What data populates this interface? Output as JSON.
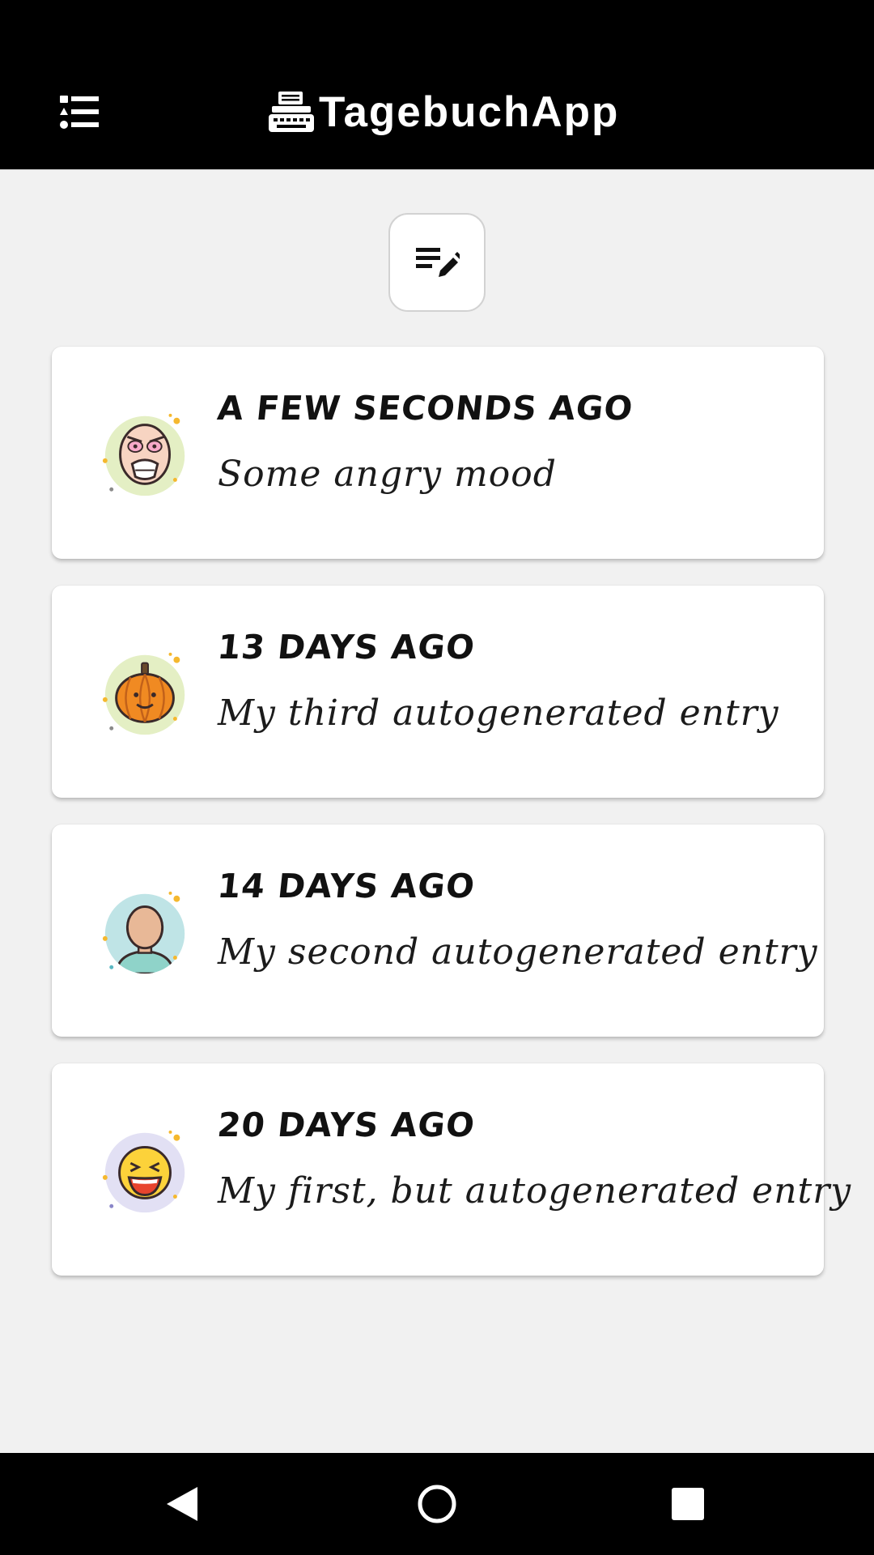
{
  "app_bar": {
    "title": "TagebuchApp",
    "menu_icon": "list-icon",
    "brand_icon": "typewriter-icon"
  },
  "compose": {
    "icon": "edit-note-icon"
  },
  "entries": [
    {
      "time": "A few seconds ago",
      "text": "Some angry mood",
      "mood_icon": "angry-face-icon"
    },
    {
      "time": "13 days ago",
      "text": "My third autogenerated entry",
      "mood_icon": "pumpkin-icon"
    },
    {
      "time": "14 days ago",
      "text": "My second autogenerated entry",
      "mood_icon": "person-icon"
    },
    {
      "time": "20 days ago",
      "text": "My first, but autogenerated entry",
      "mood_icon": "laughing-face-icon"
    }
  ],
  "nav": {
    "back_icon": "back-triangle-icon",
    "home_icon": "home-circle-icon",
    "recents_icon": "recents-square-icon"
  },
  "colors": {
    "bar": "#000000",
    "background": "#f1f1f1",
    "card": "#ffffff"
  }
}
